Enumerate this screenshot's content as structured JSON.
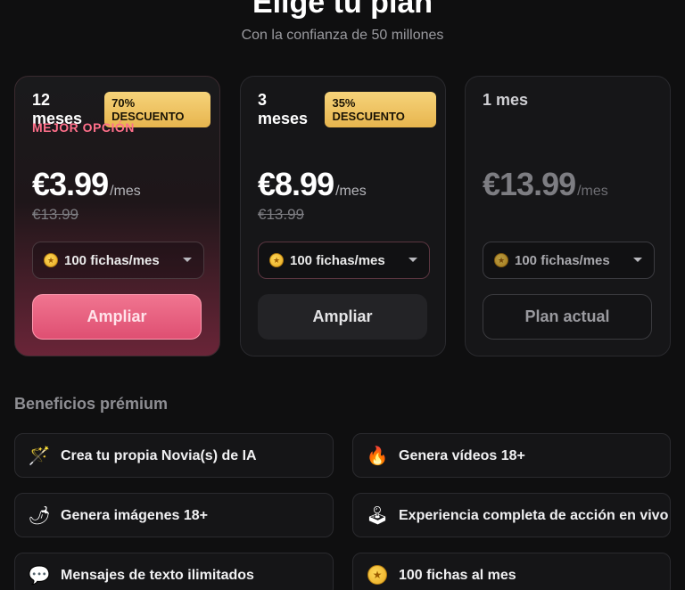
{
  "header": {
    "title": "Elige tu plan",
    "subtitle": "Con la confianza de 50 millones"
  },
  "plans": [
    {
      "term": "12 meses",
      "badge": "70% DESCUENTO",
      "highlight": "MEJOR OPCIÓN",
      "price": "€3.99",
      "per": "/mes",
      "old_price": "€13.99",
      "tokens": "100 fichas/mes",
      "button": "Ampliar"
    },
    {
      "term": "3 meses",
      "badge": "35% DESCUENTO",
      "price": "€8.99",
      "per": "/mes",
      "old_price": "€13.99",
      "tokens": "100 fichas/mes",
      "button": "Ampliar"
    },
    {
      "term": "1 mes",
      "price": "€13.99",
      "per": "/mes",
      "tokens": "100 fichas/mes",
      "button": "Plan actual"
    }
  ],
  "benefits": {
    "title": "Beneficios prémium",
    "items": [
      {
        "icon": "magic-wand-icon",
        "label": "Crea tu propia Novia(s) de IA"
      },
      {
        "icon": "fire-icon",
        "label": "Genera vídeos 18+"
      },
      {
        "icon": "chili-pepper-icon",
        "label": "Genera imágenes 18+"
      },
      {
        "icon": "joystick-icon",
        "label": "Experiencia completa de acción en vivo"
      },
      {
        "icon": "chat-bubble-icon",
        "label": "Mensajes de texto ilimitados"
      },
      {
        "icon": "coin-icon",
        "label": "100 fichas al mes"
      }
    ]
  },
  "colors": {
    "accent_pink": "#df4f72",
    "badge_gold": "#e7b54e",
    "best_option": "#ff6f8a"
  }
}
